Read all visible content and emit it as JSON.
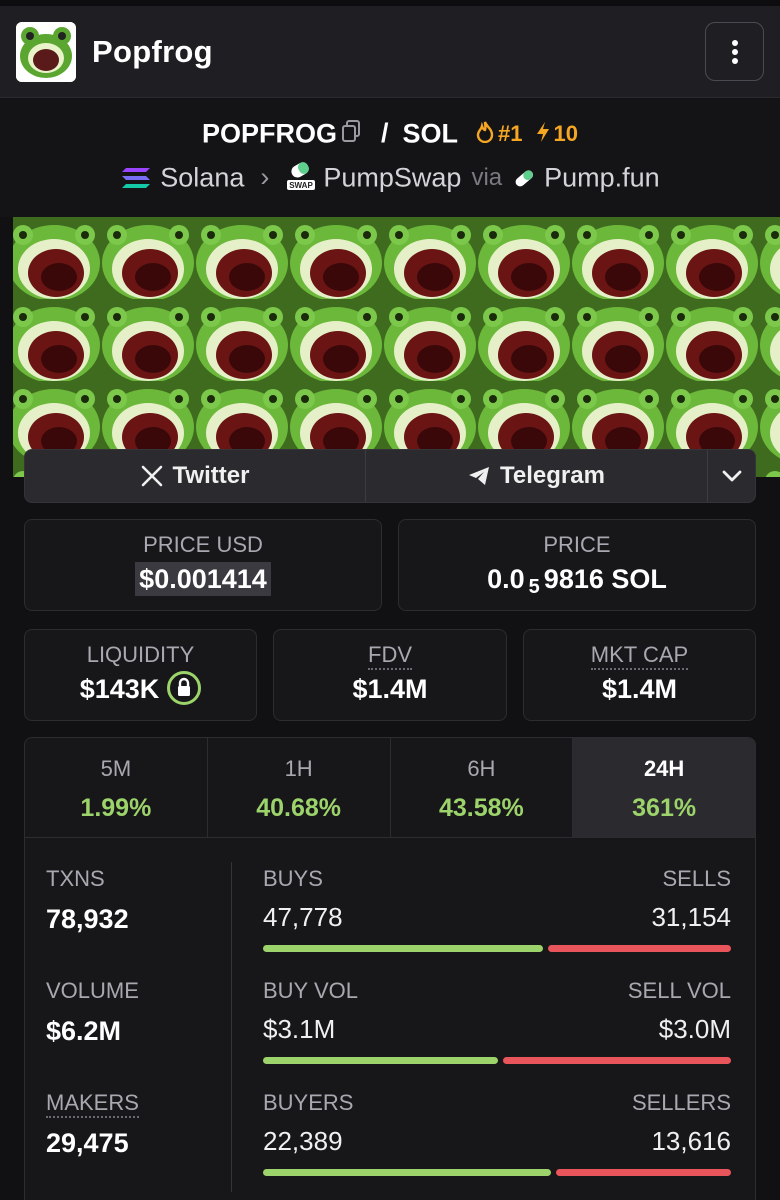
{
  "app": {
    "title": "Popfrog"
  },
  "pair": {
    "base": "POPFROG",
    "separator": "/",
    "quote": "SOL",
    "rank": "#1",
    "boosts": "10"
  },
  "chain": {
    "name": "Solana",
    "dex": "PumpSwap",
    "via": "via",
    "launchpad": "Pump.fun"
  },
  "socials": {
    "twitter": "Twitter",
    "telegram": "Telegram"
  },
  "price": {
    "usd_label": "PRICE USD",
    "usd_value": "$0.001414",
    "native_label": "PRICE",
    "native_prefix": "0.0",
    "native_zeros": "5",
    "native_digits": "9816 SOL"
  },
  "metrics": {
    "liquidity_label": "LIQUIDITY",
    "liquidity_value": "$143K",
    "fdv_label": "FDV",
    "fdv_value": "$1.4M",
    "mcap_label": "MKT CAP",
    "mcap_value": "$1.4M"
  },
  "timeframes": [
    {
      "label": "5M",
      "change": "1.99%"
    },
    {
      "label": "1H",
      "change": "40.68%"
    },
    {
      "label": "6H",
      "change": "43.58%"
    },
    {
      "label": "24H",
      "change": "361%"
    }
  ],
  "stats": {
    "txns": {
      "label": "TXNS",
      "value": "78,932",
      "left_label": "BUYS",
      "left_value": "47,778",
      "right_label": "SELLS",
      "right_value": "31,154",
      "buy_fraction": 0.605
    },
    "volume": {
      "label": "VOLUME",
      "value": "$6.2M",
      "left_label": "BUY VOL",
      "left_value": "$3.1M",
      "right_label": "SELL VOL",
      "right_value": "$3.0M",
      "buy_fraction": 0.508
    },
    "makers": {
      "label": "MAKERS",
      "value": "29,475",
      "left_label": "BUYERS",
      "left_value": "22,389",
      "right_label": "SELLERS",
      "right_value": "13,616",
      "buy_fraction": 0.622
    }
  },
  "colors": {
    "positive": "#9cd36a",
    "negative": "#e8555a",
    "accent": "#f5a623",
    "background": "#111114"
  }
}
